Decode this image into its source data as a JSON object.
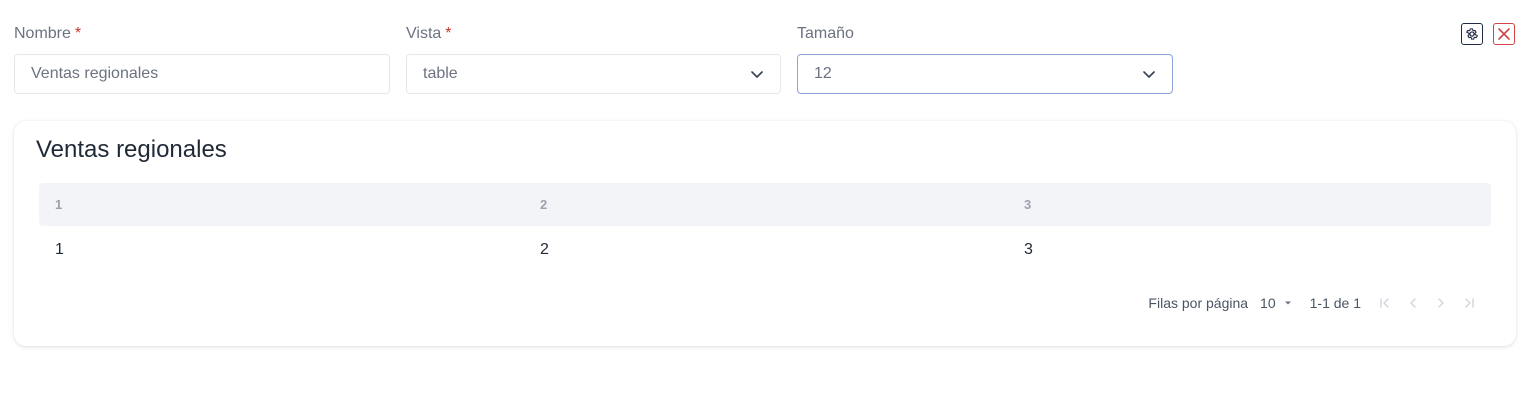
{
  "form": {
    "nombre": {
      "label": "Nombre",
      "required_mark": "*",
      "value": "Ventas regionales"
    },
    "vista": {
      "label": "Vista",
      "required_mark": "*",
      "value": "table"
    },
    "tamano": {
      "label": "Tamaño",
      "value": "12"
    }
  },
  "actions": {
    "settings_icon": "gear-icon",
    "close_icon": "close-icon",
    "close_color": "#d04545"
  },
  "card": {
    "title": "Ventas regionales",
    "table": {
      "headers": [
        "1",
        "2",
        "3"
      ],
      "rows": [
        [
          "1",
          "2",
          "3"
        ]
      ]
    },
    "pagination": {
      "rows_per_page_label": "Filas por página",
      "rows_per_page_value": "10",
      "range_text": "1-1 de 1"
    }
  }
}
